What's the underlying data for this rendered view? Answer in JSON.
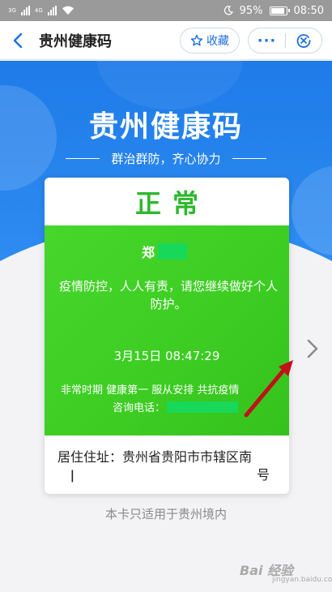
{
  "status_bar": {
    "signal_labels": [
      "3G",
      "4G"
    ],
    "battery": "95%",
    "time": "08:50"
  },
  "nav": {
    "title": "贵州健康码",
    "favorite_label": "收藏",
    "more_label": "···"
  },
  "hero": {
    "title": "贵州健康码",
    "slogan": "群治群防，齐心协力"
  },
  "card": {
    "status": "正常",
    "name": "郑",
    "notice": "疫情防控，人人有责，请您继续做好个人防护。",
    "scan_time": "3月15日 08:47:29",
    "motto": "非常时期 健康第一 服从安排 共抗疫情",
    "phone_label": "咨询电话：",
    "address_line1": "居住住址：贵州省贵阳市市辖区南",
    "address_line2_left": "ǀ",
    "address_line2_right": "号"
  },
  "footer": {
    "note": "本卡只适用于贵州境内"
  },
  "watermark": {
    "text": "Bai 经验",
    "sub": "jingyan.baidu.com"
  },
  "colors": {
    "brand_blue": "#1e7be8",
    "status_green": "#2eb82e",
    "panel_green": "#3ccc22",
    "annotation_red": "#c0111a"
  }
}
